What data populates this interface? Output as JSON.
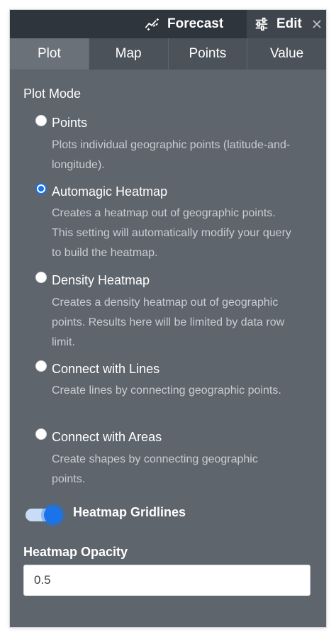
{
  "header": {
    "forecast_label": "Forecast",
    "edit_label": "Edit"
  },
  "tabs": [
    {
      "label": "Plot",
      "active": true
    },
    {
      "label": "Map",
      "active": false
    },
    {
      "label": "Points",
      "active": false
    },
    {
      "label": "Value",
      "active": false
    }
  ],
  "plot_mode": {
    "title": "Plot Mode",
    "options": [
      {
        "label": "Points",
        "description": "Plots individual geographic points (latitude-and-longitude).",
        "checked": false
      },
      {
        "label": "Automagic Heatmap",
        "description": "Creates a heatmap out of geographic points. This setting will automatically modify your query to build the heatmap.",
        "checked": true
      },
      {
        "label": "Density Heatmap",
        "description": "Creates a density heatmap out of geographic points. Results here will be limited by data row limit.",
        "checked": false
      },
      {
        "label": "Connect with Lines",
        "description": "Create lines by connecting geographic points.",
        "checked": false
      },
      {
        "label": "Connect with Areas",
        "description": "Create shapes by connecting geographic points.",
        "checked": false
      }
    ]
  },
  "gridlines": {
    "label": "Heatmap Gridlines",
    "enabled": true
  },
  "opacity": {
    "label": "Heatmap Opacity",
    "value": "0.5"
  },
  "colors": {
    "panel_bg": "#5f656d",
    "header_bg": "#2f353d",
    "accent": "#1a73e8"
  }
}
